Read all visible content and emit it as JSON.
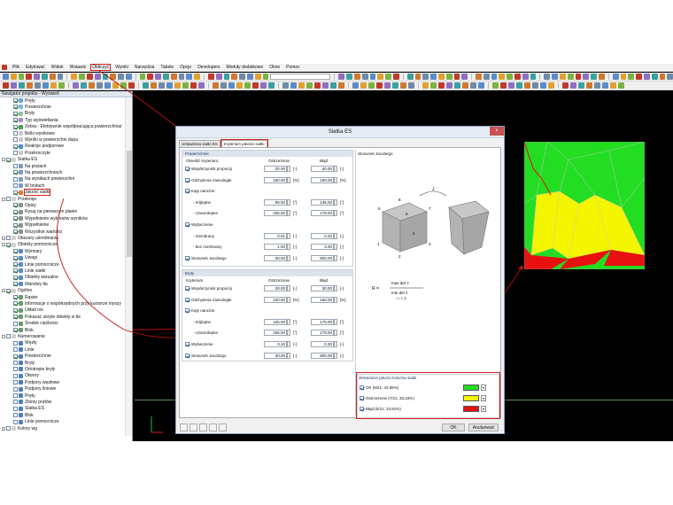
{
  "menubar": {
    "items": [
      "Plik",
      "Edytować",
      "Widok",
      "Wstawić",
      "Obliczyć",
      "Wyniki",
      "Narzędzia",
      "Tabele",
      "Opcje",
      "Developers",
      "Moduły dodatkowe",
      "Okno",
      "Pomoc"
    ],
    "highlighted": "Obliczyć"
  },
  "navigator": {
    "title": "Navigator projektu - Wyświetl",
    "items": [
      {
        "label": "Pręty",
        "level": 2,
        "checked": true,
        "color": "#6fa3d8"
      },
      {
        "label": "Powierzchnie",
        "level": 2,
        "checked": true,
        "color": "#7fb8e0"
      },
      {
        "label": "Bryły",
        "level": 2,
        "checked": true,
        "color": "#8fc6a0"
      },
      {
        "label": "Typ wyświetlania",
        "level": 2,
        "checked": true,
        "color": "#b38ad0"
      },
      {
        "label": "Zebra - Efektywnie współpracująca powierzchnia/",
        "level": 2,
        "checked": true,
        "color": "#50a050"
      },
      {
        "label": "Belki wynikowe",
        "level": 2,
        "checked": false,
        "color": "#c8c8c8"
      },
      {
        "label": "Wyniki w powierzchni dupa",
        "level": 2,
        "checked": false,
        "color": "#c8c8c8"
      },
      {
        "label": "Reakcje podporowe",
        "level": 2,
        "checked": true,
        "color": "#4a8fd0"
      },
      {
        "label": "Przekroczyte",
        "level": 2,
        "checked": false,
        "color": "#c8c8c8"
      },
      {
        "label": "Siatka ES",
        "level": 1,
        "checked": true,
        "color": "#d0d0d0"
      },
      {
        "label": "Na prętach",
        "level": 2,
        "checked": false,
        "color": "#7a9cc0"
      },
      {
        "label": "Na powierzchniach",
        "level": 2,
        "checked": true,
        "color": "#7a9cc0"
      },
      {
        "label": "Na wynikach powierzchni",
        "level": 2,
        "checked": false,
        "color": "#7a9cc0"
      },
      {
        "label": "W bryłach",
        "level": 2,
        "checked": false,
        "color": "#7a9cc0"
      },
      {
        "label": "Jakość siatki",
        "level": 2,
        "checked": true,
        "color": "#e07830",
        "selected": true
      },
      {
        "label": "Przekroje",
        "level": 1,
        "checked": false,
        "color": "#d0d0d0"
      },
      {
        "label": "Opisy",
        "level": 2,
        "checked": true,
        "color": "#909090"
      },
      {
        "label": "Rysuj na pierwszym planie",
        "level": 2,
        "checked": true,
        "color": "#909090"
      },
      {
        "label": "Wypełnienie wykresów wyników",
        "level": 2,
        "checked": true,
        "color": "#909090"
      },
      {
        "label": "Wypełnienie",
        "level": 2,
        "checked": true,
        "color": "#909090"
      },
      {
        "label": "Wszystkie wartości",
        "level": 2,
        "checked": true,
        "color": "#909090"
      },
      {
        "label": "Obszary uśredniania",
        "level": 1,
        "checked": false,
        "color": "#d0d0d0"
      },
      {
        "label": "Obiekty pomocnicze",
        "level": 1,
        "checked": true,
        "color": "#d0d0d0"
      },
      {
        "label": "Wymiary",
        "level": 2,
        "checked": true,
        "color": "#5b8bc8"
      },
      {
        "label": "Uwagi",
        "level": 2,
        "checked": true,
        "color": "#5b8bc8"
      },
      {
        "label": "Linie pomocnicze",
        "level": 2,
        "checked": true,
        "color": "#5b8bc8"
      },
      {
        "label": "Linie siatki",
        "level": 2,
        "checked": true,
        "color": "#5b8bc8"
      },
      {
        "label": "Obiekty wizualne",
        "level": 2,
        "checked": true,
        "color": "#5b8bc8"
      },
      {
        "label": "Warstwy tła",
        "level": 2,
        "checked": true,
        "color": "#5b8bc8"
      },
      {
        "label": "Ogólne",
        "level": 1,
        "checked": true,
        "color": "#d0d0d0"
      },
      {
        "label": "Raster",
        "level": 2,
        "checked": true,
        "color": "#6a9b6a"
      },
      {
        "label": "Informacje o współrzędnych przy kursorze myszy",
        "level": 2,
        "checked": true,
        "color": "#6a9b6a"
      },
      {
        "label": "Układ osi",
        "level": 2,
        "checked": true,
        "color": "#6a9b6a"
      },
      {
        "label": "Pokazać ukryte obiekty w tle",
        "level": 2,
        "checked": true,
        "color": "#6a9b6a"
      },
      {
        "label": "Środek ciężkości",
        "level": 2,
        "checked": false,
        "color": "#6a9b6a"
      },
      {
        "label": "Blok",
        "level": 2,
        "checked": true,
        "color": "#6a9b6a"
      },
      {
        "label": "Numerowanie",
        "level": 1,
        "checked": false,
        "color": "#d0d0d0"
      },
      {
        "label": "Węzły",
        "level": 2,
        "checked": false,
        "color": "#4f7fb8"
      },
      {
        "label": "Linie",
        "level": 2,
        "checked": false,
        "color": "#4f7fb8"
      },
      {
        "label": "Powierzchnie",
        "level": 2,
        "checked": true,
        "color": "#4f7fb8"
      },
      {
        "label": "Bryły",
        "level": 2,
        "checked": false,
        "color": "#4f7fb8"
      },
      {
        "label": "Ortotropie bryły",
        "level": 2,
        "checked": false,
        "color": "#4f7fb8"
      },
      {
        "label": "Otwory",
        "level": 2,
        "checked": false,
        "color": "#4f7fb8"
      },
      {
        "label": "Podpory węzłowe",
        "level": 2,
        "checked": false,
        "color": "#4f7fb8"
      },
      {
        "label": "Podpory liniowe",
        "level": 2,
        "checked": false,
        "color": "#4f7fb8"
      },
      {
        "label": "Pręty",
        "level": 2,
        "checked": false,
        "color": "#4f7fb8"
      },
      {
        "label": "Zbiory prętów",
        "level": 2,
        "checked": false,
        "color": "#4f7fb8"
      },
      {
        "label": "Siatka ES",
        "level": 2,
        "checked": false,
        "color": "#4f7fb8"
      },
      {
        "label": "Blok",
        "level": 2,
        "checked": false,
        "color": "#4f7fb8"
      },
      {
        "label": "Linie pomocnicze",
        "level": 2,
        "checked": false,
        "color": "#4f7fb8"
      },
      {
        "label": "Kolory wg",
        "level": 1,
        "checked": false,
        "color": "#d0d0d0"
      }
    ]
  },
  "dialog": {
    "title": "Siatka ES",
    "close": "×",
    "tabs": [
      "Ustawienia siatki ES",
      "Kryterium jakości siatki"
    ],
    "active_tab": 1,
    "surfaces": {
      "header": "Powierzchnie",
      "criteria_label": "Określić kryterium:",
      "col_warning": "Ostrzeżenie",
      "col_error": "Błąd",
      "rows": [
        {
          "label": "Współczynnik proporcji",
          "checked": true,
          "warn": "20.00",
          "warn_unit": "[-]",
          "err": "30.00",
          "err_unit": "[-]"
        },
        {
          "label": "Odchylenia równoległe",
          "checked": true,
          "warn": "100.00",
          "warn_unit": "[%]",
          "err": "160.00",
          "err_unit": "[%]"
        },
        {
          "label": "Kąty narożne",
          "checked": true,
          "group": true
        },
        {
          "label": "- trójkątne",
          "indent": true,
          "warn": "95.00",
          "warn_unit": "[°]",
          "err": "135.00",
          "err_unit": "[°]"
        },
        {
          "label": "- czworokątne",
          "indent": true,
          "warn": "155.00",
          "warn_unit": "[°]",
          "err": "179.00",
          "err_unit": "[°]"
        },
        {
          "label": "Wybaczenie",
          "checked": true,
          "group": true
        },
        {
          "label": "- membrany",
          "indent": true,
          "warn": "0.01",
          "warn_unit": "[-]",
          "err": "0.20",
          "err_unit": "[-]"
        },
        {
          "label": "- bez membrany",
          "indent": true,
          "warn": "1.00",
          "warn_unit": "[-]",
          "err": "4.00",
          "err_unit": "[-]"
        },
        {
          "label": "Stosunek Jacobego",
          "checked": true,
          "warn": "30.00",
          "warn_unit": "[-]",
          "err": "800.00",
          "err_unit": "[-]"
        }
      ]
    },
    "solids": {
      "header": "Bryły",
      "criteria_label": "Kryterium",
      "col_warning": "Ostrzeżenie",
      "col_error": "Błąd",
      "rows": [
        {
          "label": "Współczynnik proporcji",
          "checked": true,
          "warn": "20.00",
          "warn_unit": "[-]",
          "err": "30.00",
          "err_unit": "[-]"
        },
        {
          "label": "Odchylenia równoległe",
          "checked": true,
          "warn": "100.00",
          "warn_unit": "[%]",
          "err": "160.00",
          "err_unit": "[%]"
        },
        {
          "label": "Kąty narożne",
          "checked": true,
          "group": true
        },
        {
          "label": "- trójkątne",
          "indent": true,
          "warn": "105.00",
          "warn_unit": "[°]",
          "err": "175.00",
          "err_unit": "[°]"
        },
        {
          "label": "- czworokątne",
          "indent": true,
          "warn": "155.00",
          "warn_unit": "[°]",
          "err": "179.00",
          "err_unit": "[°]"
        },
        {
          "label": "Wybaczenie",
          "checked": true,
          "warn": "0.10",
          "warn_unit": "[-]",
          "err": "0.30",
          "err_unit": "[-]"
        },
        {
          "label": "Stosunek Jacobego",
          "checked": true,
          "warn": "30.00",
          "warn_unit": "[-]",
          "err": "800.00",
          "err_unit": "[-]"
        }
      ]
    },
    "preview": {
      "title": "Stosunek Jacobego",
      "formula_lhs": "R =",
      "formula_num": "max det J",
      "formula_den": "min det J",
      "formula_sub": "i = 1..8",
      "cube_labels": [
        "1",
        "2",
        "3",
        "4",
        "5",
        "6",
        "7",
        "8"
      ],
      "arrow_label": "J"
    },
    "legend": {
      "header": "Wskazanie jakości kolorów siatki",
      "rows": [
        {
          "label": "OK (9/21; 42.86%)",
          "color": "#22dd22",
          "checked": true
        },
        {
          "label": "Ostrzeżenie (7/21; 33.33%)",
          "color": "#f5f500",
          "checked": true
        },
        {
          "label": "Błąd (5/21; 23.81%)",
          "color": "#e81010",
          "checked": true
        }
      ]
    },
    "buttons": {
      "ok": "OK",
      "cancel": "Anuluować"
    }
  },
  "colors": {
    "ok": "#22dd22",
    "warning": "#f5f500",
    "error": "#e81010",
    "highlight": "#d32020"
  }
}
